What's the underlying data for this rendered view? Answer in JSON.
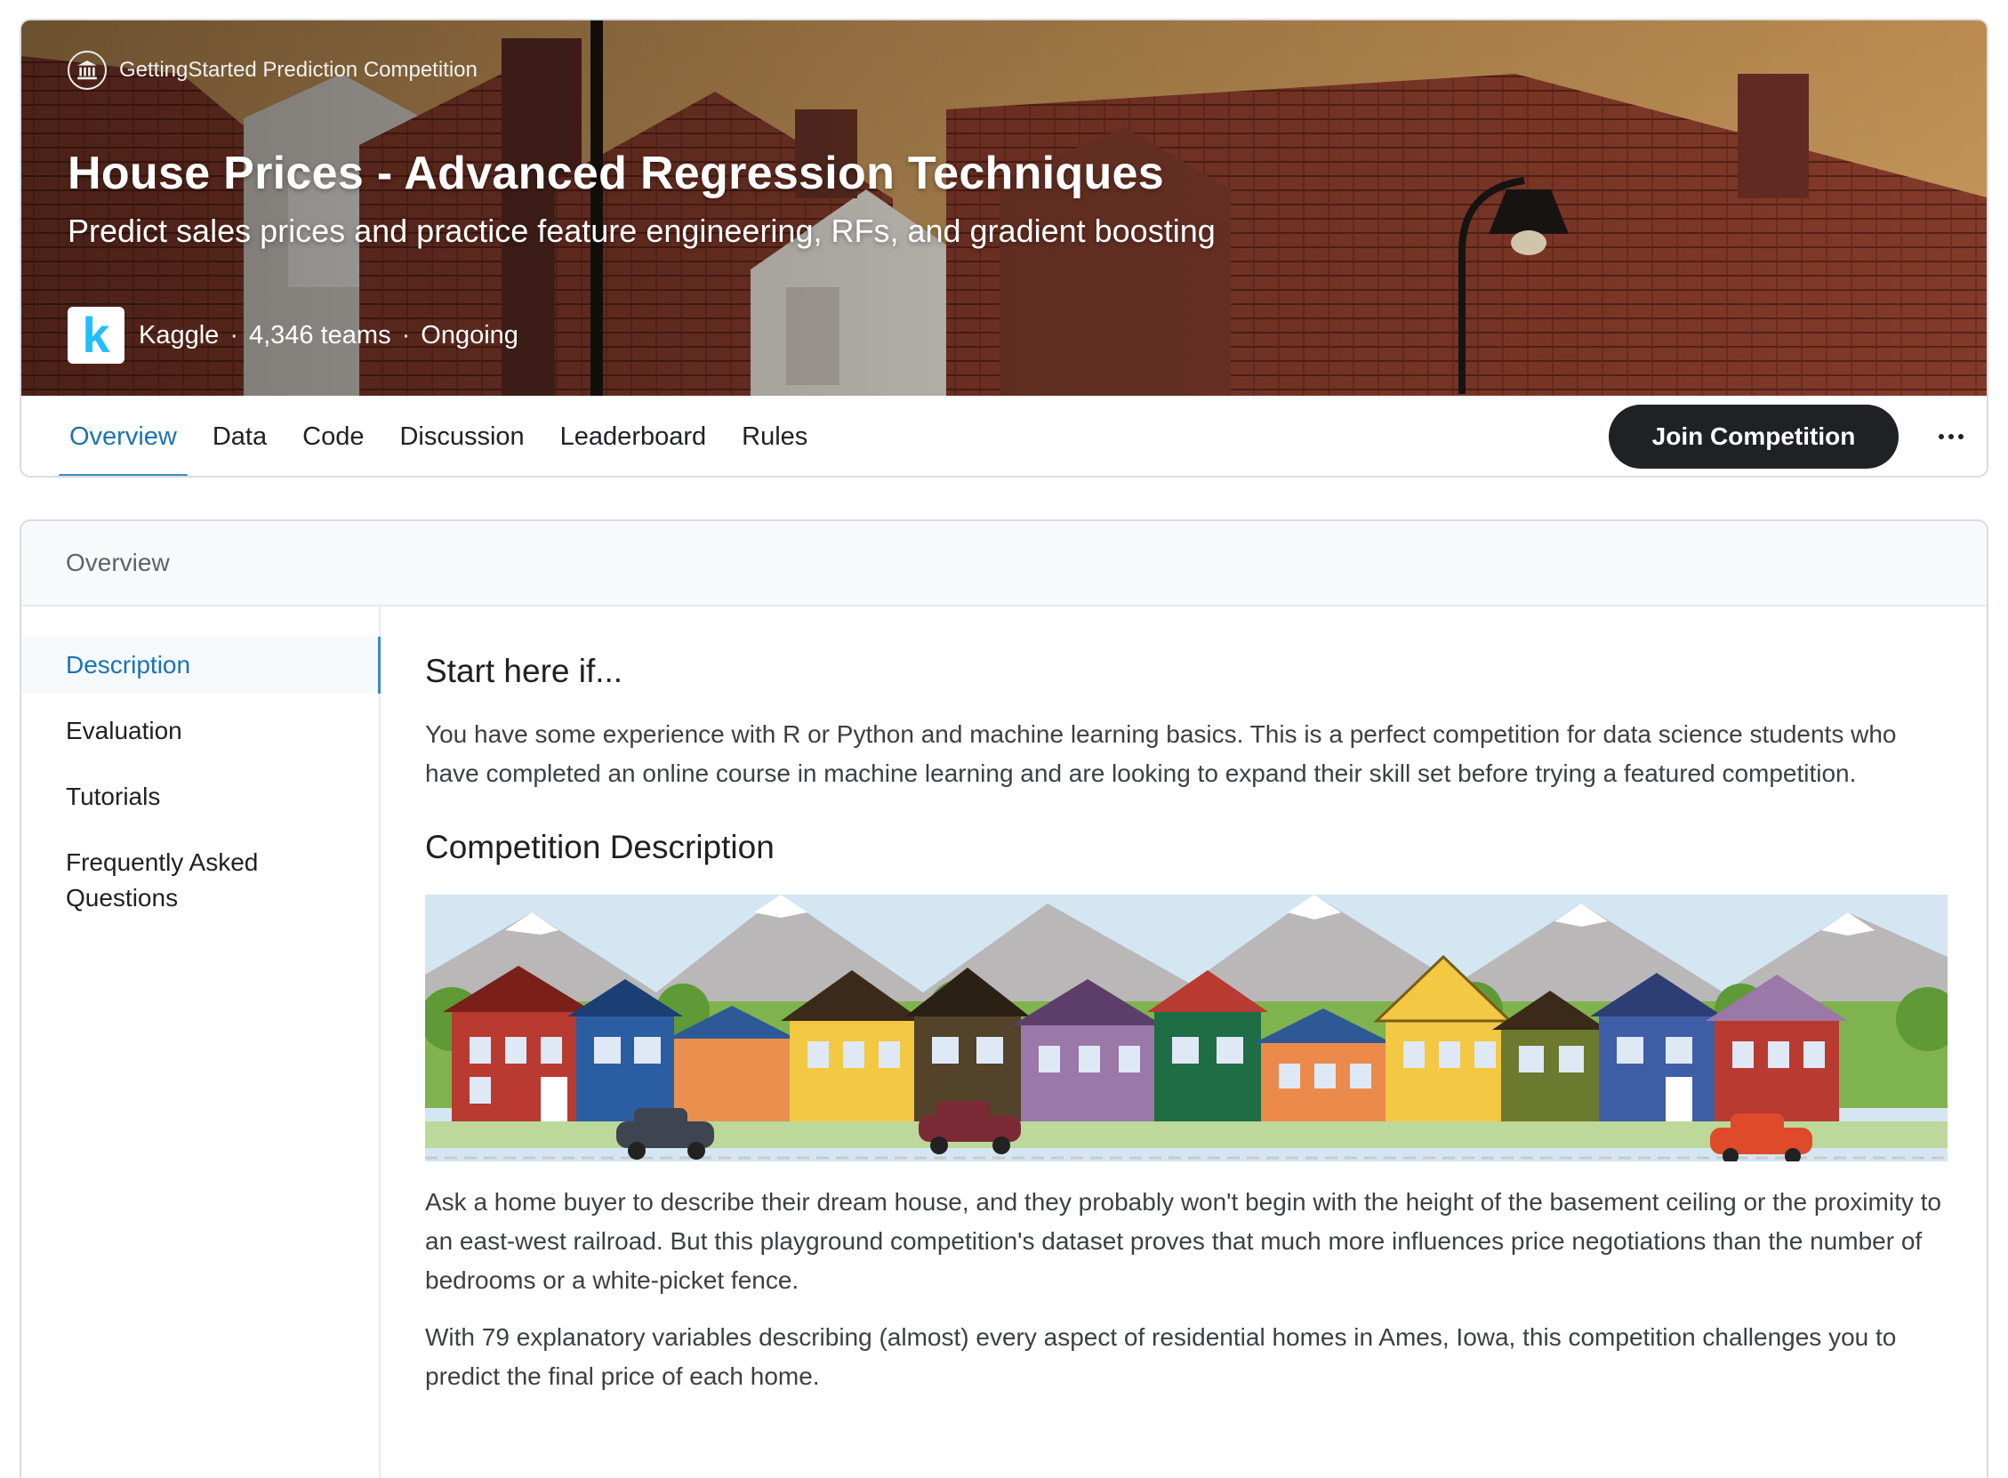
{
  "banner": {
    "competition_type": "GettingStarted Prediction Competition",
    "title": "House Prices - Advanced Regression Techniques",
    "subtitle": "Predict sales prices and practice feature engineering, RFs, and gradient boosting",
    "host_logo_letter": "k",
    "host": "Kaggle",
    "teams": "4,346 teams",
    "status": "Ongoing",
    "separator": "·"
  },
  "tabs": [
    {
      "label": "Overview",
      "active": true
    },
    {
      "label": "Data"
    },
    {
      "label": "Code"
    },
    {
      "label": "Discussion"
    },
    {
      "label": "Leaderboard"
    },
    {
      "label": "Rules"
    }
  ],
  "actions": {
    "join_label": "Join Competition",
    "more_icon": "more-horizontal-icon"
  },
  "overview": {
    "section_title": "Overview",
    "sidebar": [
      {
        "label": "Description",
        "active": true
      },
      {
        "label": "Evaluation"
      },
      {
        "label": "Tutorials"
      },
      {
        "label": "Frequently Asked Questions"
      }
    ],
    "heading_1": "Start here if...",
    "para_1": "You have some experience with R or Python and machine learning basics. This is a perfect competition for data science students who have completed an online course in machine learning and are looking to expand their skill set before trying a featured competition.",
    "heading_2": "Competition Description",
    "para_2": "Ask a home buyer to describe their dream house, and they probably won't begin with the height of the basement ceiling or the proximity to an east-west railroad. But this playground competition's dataset proves that much more influences price negotiations than the number of bedrooms or a white-picket fence.",
    "para_3": "With 79 explanatory variables describing (almost) every aspect of residential homes in Ames, Iowa, this competition challenges you to predict the final price of each home."
  },
  "colors": {
    "accent": "#1a73b4",
    "join_bg": "#202124",
    "kaggle_blue": "#20beff"
  }
}
